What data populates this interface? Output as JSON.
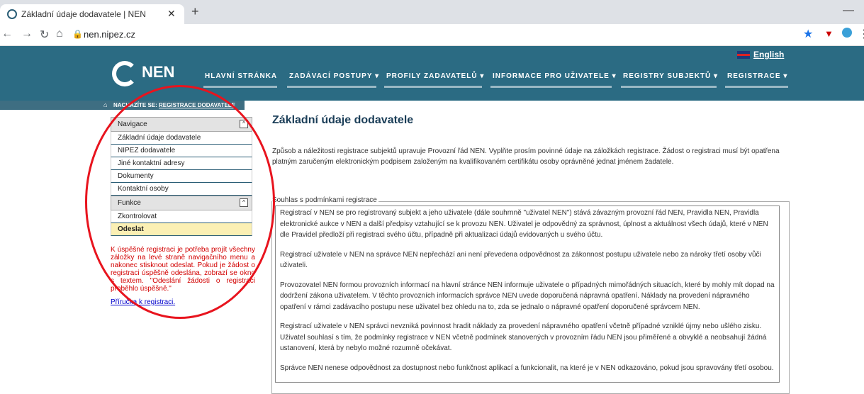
{
  "browser": {
    "tab_title": "Základní údaje dodavatele | NEN",
    "url": "nen.nipez.cz"
  },
  "header": {
    "lang": "English",
    "logo": "NEN",
    "menu": [
      "HLAVNÍ STRÁNKA",
      "ZADÁVACÍ POSTUPY ▾",
      "PROFILY ZADAVATELŮ ▾",
      "INFORMACE PRO UŽIVATELE ▾",
      "REGISTRY SUBJEKTŮ ▾",
      "REGISTRACE ▾"
    ],
    "breadcrumb_label": "NACHÁZÍTE SE:",
    "breadcrumb_link": "REGISTRACE DODAVATELE"
  },
  "sidebar": {
    "nav_title": "Navigace",
    "nav_items": [
      "Základní údaje dodavatele",
      "NIPEZ dodavatele",
      "Jiné kontaktní adresy",
      "Dokumenty",
      "Kontaktní osoby"
    ],
    "func_title": "Funkce",
    "func_items": [
      "Zkontrolovat",
      "Odeslat"
    ],
    "note": "K úspěšné registraci je potřeba projít všechny záložky na levé straně navigačního menu a nakonec stisknout odeslat. Pokud je žádost o registraci úspěšně odeslána, zobrazí se okno s textem. \"Odeslání žádosti o registraci proběhlo úspěšně.\"",
    "guide": "Příručka k registraci."
  },
  "main": {
    "title": "Základní údaje dodavatele",
    "intro": "Způsob a náležitosti registrace subjektů upravuje Provozní řád NEN. Vyplňte prosím povinné údaje na záložkách registrace. Žádost o registraci musí být opatřena platným zaručeným elektronickým podpisem založeným na kvalifikovaném certifikátu osoby oprávněné jednat jménem žadatele.",
    "legend": "Souhlas s podmínkami registrace",
    "paragraphs": [
      "Registrací v NEN se pro registrovaný subjekt a jeho uživatele (dále souhrnně \"uživatel NEN\") stává závazným provozní řád NEN, Pravidla NEN, Pravidla elektronické aukce v NEN a další předpisy vztahující se k provozu NEN. Uživatel je odpovědný za správnost, úplnost a aktuálnost všech údajů, které v NEN dle Pravidel předloží při registraci svého účtu, případně při aktualizaci údajů evidovaných u svého účtu.",
      "Registrací uživatele v NEN na správce NEN nepřechází ani není převedena odpovědnost za zákonnost postupu uživatele nebo za nároky třetí osoby vůči uživateli.",
      "Provozovatel NEN formou provozních informací na hlavní stránce NEN informuje uživatele o případných mimořádných situacích, které by mohly mít dopad na dodržení zákona uživatelem. V těchto provozních informacích správce NEN uvede doporučená nápravná opatření. Náklady na provedení nápravného opatření v rámci zadávacího postupu nese uživatel bez ohledu na to, zda se jednalo o nápravné opatření doporučené správcem NEN.",
      "Registrací uživatele v NEN správci nevzniká povinnost hradit náklady za provedení nápravného opatření včetně případné vzniklé újmy nebo ušlého zisku. Uživatel souhlasí s tím, že podmínky registrace v NEN včetně podmínek stanovených v provozním řádu NEN jsou přiměřené a obvyklé a neobsahují žádná ustanovení, která by nebylo možné rozumně očekávat.",
      "Správce NEN nenese odpovědnost za dostupnost nebo funkčnost aplikací a funkcionalit, na které je v NEN odkazováno, pokud jsou spravovány třetí osobou."
    ]
  }
}
